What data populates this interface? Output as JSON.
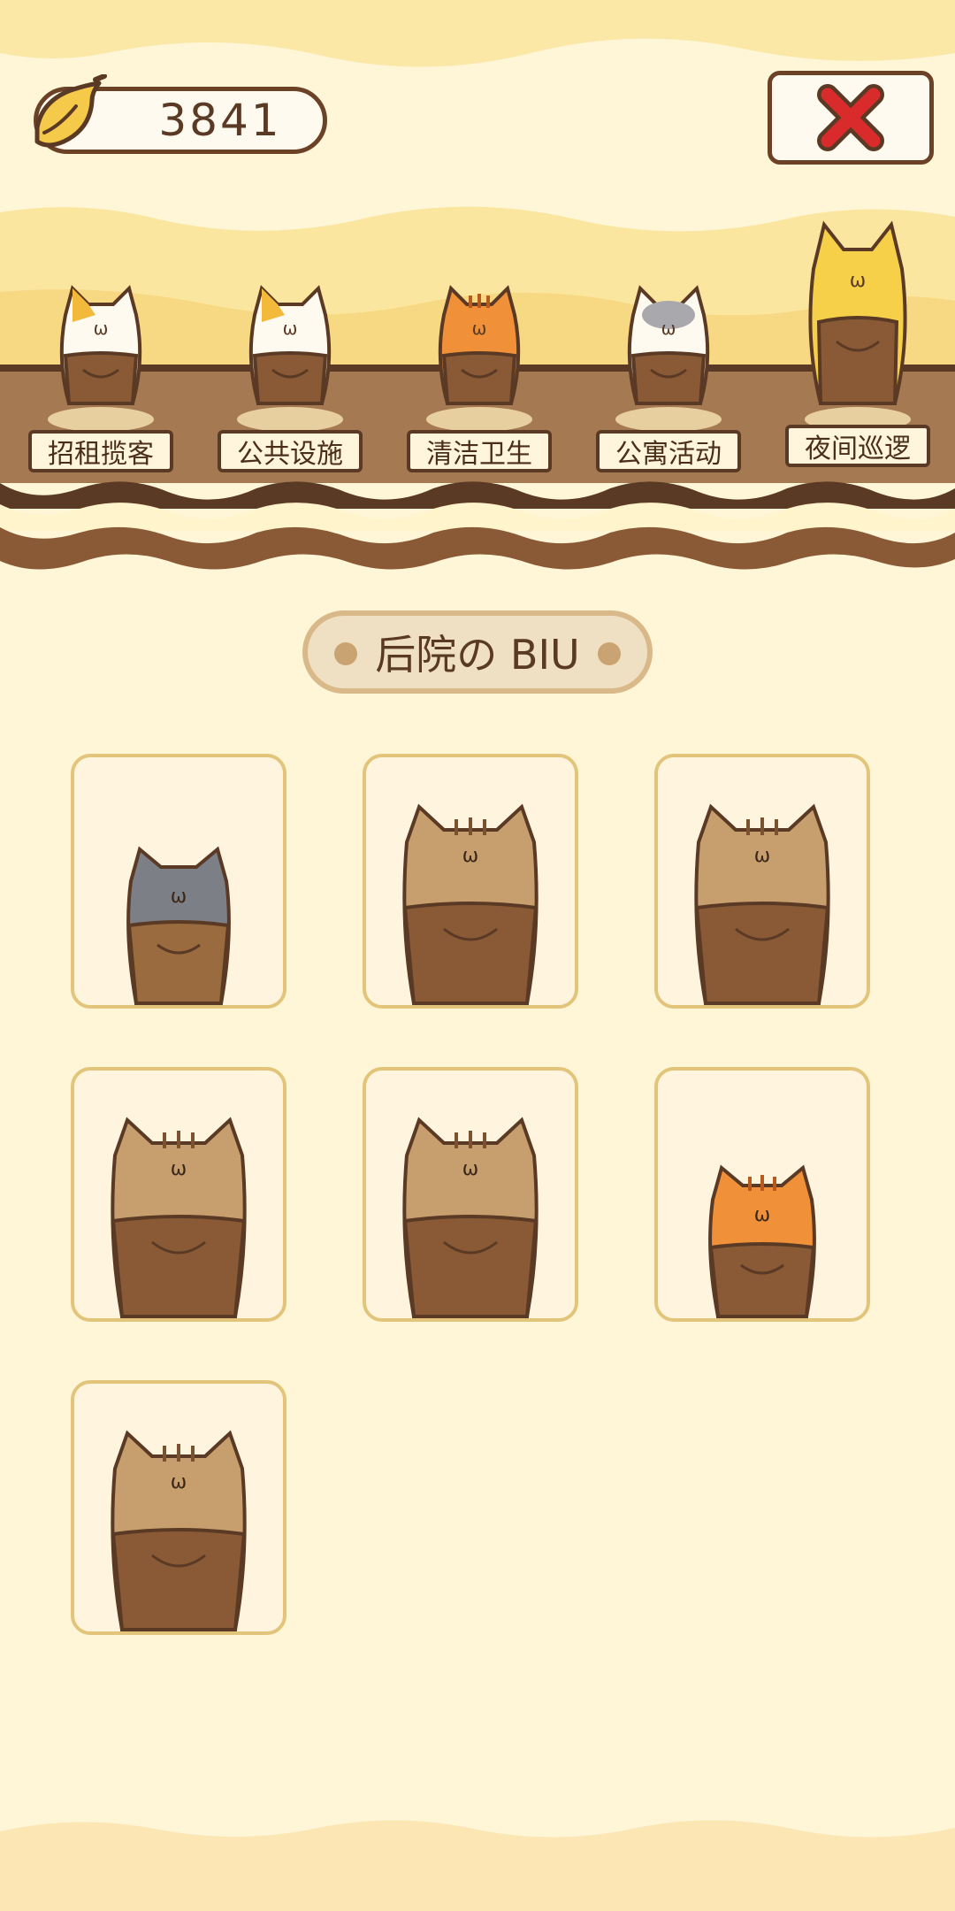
{
  "currency": {
    "value": "3841",
    "icon": "banana-icon"
  },
  "close_button": {
    "icon": "close-x-icon",
    "color": "#d92b2b"
  },
  "departments": [
    {
      "label": "招租揽客",
      "cat": "calico"
    },
    {
      "label": "公共设施",
      "cat": "calico"
    },
    {
      "label": "清洁卫生",
      "cat": "orange-tabby"
    },
    {
      "label": "公寓活动",
      "cat": "gray-white"
    },
    {
      "label": "夜间巡逻",
      "cat": "yellow"
    }
  ],
  "section": {
    "title": "后院の BIU"
  },
  "cats": [
    {
      "type": "gray-cat"
    },
    {
      "type": "brown-tabby-cat"
    },
    {
      "type": "brown-tabby-cat"
    },
    {
      "type": "brown-tabby-cat"
    },
    {
      "type": "brown-tabby-cat"
    },
    {
      "type": "orange-tabby-cat"
    },
    {
      "type": "brown-tabby-cat"
    }
  ],
  "colors": {
    "background": "#fff6d8",
    "outline": "#5a3a24",
    "card_border": "#e2c57a"
  }
}
